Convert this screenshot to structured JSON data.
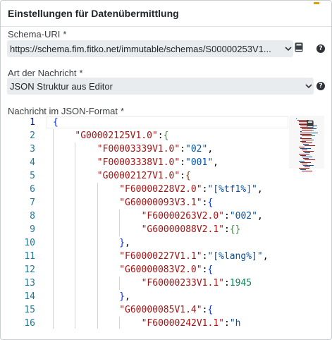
{
  "panel": {
    "title": "Einstellungen für Datenübermittlung"
  },
  "schema": {
    "label": "Schema-URI",
    "required_mark": "*",
    "value": "https://schema.fim.fitko.net/immutable/schemas/S00000253V1..."
  },
  "message_type": {
    "label": "Art der Nachricht",
    "required_mark": "*",
    "value": "JSON Struktur aus Editor"
  },
  "json_editor": {
    "label": "Nachricht im JSON-Format",
    "required_mark": "*",
    "active_line": 1,
    "lines": [
      {
        "n": "1",
        "indent": 0,
        "tokens": [
          {
            "t": "{",
            "c": "p0"
          }
        ]
      },
      {
        "n": "2",
        "indent": 1,
        "tokens": [
          {
            "t": "\"G00002125V1.0\"",
            "c": "k"
          },
          {
            "t": ":",
            "c": ""
          },
          {
            "t": "{",
            "c": "p1"
          }
        ]
      },
      {
        "n": "3",
        "indent": 2,
        "tokens": [
          {
            "t": "\"F00003339V1.0\"",
            "c": "k"
          },
          {
            "t": ":",
            "c": ""
          },
          {
            "t": "\"02\"",
            "c": "s"
          },
          {
            "t": ",",
            "c": ""
          }
        ]
      },
      {
        "n": "4",
        "indent": 2,
        "tokens": [
          {
            "t": "\"F00003338V1.0\"",
            "c": "k"
          },
          {
            "t": ":",
            "c": ""
          },
          {
            "t": "\"001\"",
            "c": "s"
          },
          {
            "t": ",",
            "c": ""
          }
        ]
      },
      {
        "n": "5",
        "indent": 2,
        "tokens": [
          {
            "t": "\"G00002127V1.0\"",
            "c": "k"
          },
          {
            "t": ":",
            "c": ""
          },
          {
            "t": "{",
            "c": "p2"
          }
        ]
      },
      {
        "n": "6",
        "indent": 3,
        "tokens": [
          {
            "t": "\"F60000228V2.0\"",
            "c": "k"
          },
          {
            "t": ":",
            "c": ""
          },
          {
            "t": "\"[%tf1%]\"",
            "c": "s"
          },
          {
            "t": ",",
            "c": ""
          }
        ]
      },
      {
        "n": "7",
        "indent": 3,
        "tokens": [
          {
            "t": "\"G60000093V3.1\"",
            "c": "k"
          },
          {
            "t": ":",
            "c": ""
          },
          {
            "t": "{",
            "c": "p0"
          }
        ]
      },
      {
        "n": "8",
        "indent": 4,
        "tokens": [
          {
            "t": "\"F60000263V2.0\"",
            "c": "k"
          },
          {
            "t": ":",
            "c": ""
          },
          {
            "t": "\"002\"",
            "c": "s"
          },
          {
            "t": ",",
            "c": ""
          }
        ]
      },
      {
        "n": "9",
        "indent": 4,
        "tokens": [
          {
            "t": "\"G60000088V2.1\"",
            "c": "k"
          },
          {
            "t": ":",
            "c": ""
          },
          {
            "t": "{}",
            "c": "p1"
          }
        ]
      },
      {
        "n": "10",
        "indent": 3,
        "tokens": [
          {
            "t": "}",
            "c": "p0"
          },
          {
            "t": ",",
            "c": ""
          }
        ]
      },
      {
        "n": "11",
        "indent": 3,
        "tokens": [
          {
            "t": "\"F60000227V1.1\"",
            "c": "k"
          },
          {
            "t": ":",
            "c": ""
          },
          {
            "t": "\"[%lang%]\"",
            "c": "s"
          },
          {
            "t": ",",
            "c": ""
          }
        ]
      },
      {
        "n": "12",
        "indent": 3,
        "tokens": [
          {
            "t": "\"G60000083V2.0\"",
            "c": "k"
          },
          {
            "t": ":",
            "c": ""
          },
          {
            "t": "{",
            "c": "p0"
          }
        ]
      },
      {
        "n": "13",
        "indent": 4,
        "tokens": [
          {
            "t": "\"F60000233V1.1\"",
            "c": "k"
          },
          {
            "t": ":",
            "c": ""
          },
          {
            "t": "1945",
            "c": "n"
          }
        ]
      },
      {
        "n": "14",
        "indent": 3,
        "tokens": [
          {
            "t": "}",
            "c": "p0"
          },
          {
            "t": ",",
            "c": ""
          }
        ]
      },
      {
        "n": "15",
        "indent": 3,
        "tokens": [
          {
            "t": "\"G60000085V1.4\"",
            "c": "k"
          },
          {
            "t": ":",
            "c": ""
          },
          {
            "t": "{",
            "c": "p0"
          }
        ]
      },
      {
        "n": "16",
        "indent": 4,
        "tokens": [
          {
            "t": "\"F60000242V1.1\"",
            "c": "k"
          },
          {
            "t": ":",
            "c": ""
          },
          {
            "t": "\"h",
            "c": "s"
          }
        ]
      }
    ]
  },
  "icons": {
    "schema_book": "book-icon",
    "schema_help": "help-icon",
    "type_help": "help-icon",
    "dropdown": "chevron-down-icon"
  },
  "colors": {
    "json_key": "#a31515",
    "json_string": "#0451a5",
    "json_number": "#098658",
    "line_number": "#237893",
    "field_bg": "#e9ecef"
  }
}
